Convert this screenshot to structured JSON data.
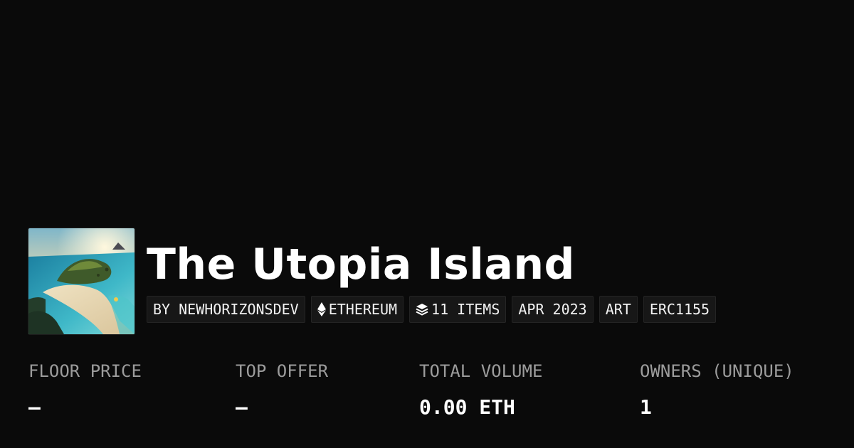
{
  "collection": {
    "title": "The Utopia Island",
    "image": "island-landscape-thumbnail"
  },
  "chips": {
    "creator": "BY NEWHORIZONSDEV",
    "chain": "ETHEREUM",
    "chain_icon": "ethereum-icon",
    "items": "11 ITEMS",
    "items_icon": "layers-icon",
    "date": "APR 2023",
    "category": "ART",
    "standard": "ERC1155"
  },
  "stats": {
    "floor_price": {
      "label": "FLOOR PRICE",
      "value": "—"
    },
    "top_offer": {
      "label": "TOP OFFER",
      "value": "—"
    },
    "total_volume": {
      "label": "TOTAL VOLUME",
      "value": "0.00 ETH"
    },
    "owners": {
      "label": "OWNERS (UNIQUE)",
      "value": "1"
    }
  },
  "colors": {
    "background": "#0a0a0a",
    "chip_background": "#171717",
    "label_gray": "#9c9c9c",
    "text": "#ffffff"
  }
}
